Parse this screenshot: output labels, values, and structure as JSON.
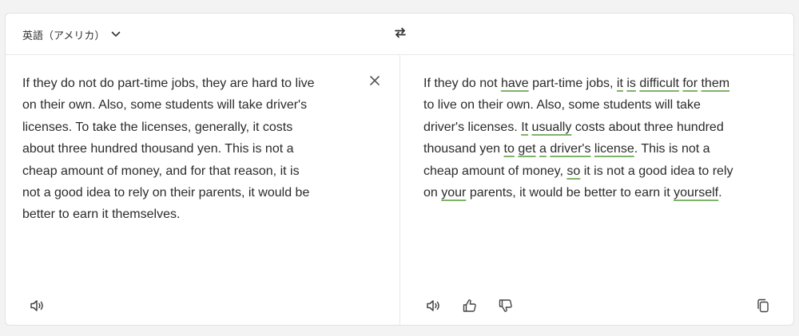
{
  "header": {
    "language_label": "英語（アメリカ）"
  },
  "icons": {
    "dropdown": "chevron-down-icon",
    "swap": "swap-arrows-icon",
    "clear": "close-icon",
    "speak": "speaker-icon",
    "like": "thumbs-up-icon",
    "dislike": "thumbs-down-icon",
    "copy": "copy-icon"
  },
  "source": {
    "lines": [
      "If they do not do part-time jobs, they are hard to live",
      "on their own. Also, some students will take driver's",
      "licenses. To take the licenses, generally, it costs",
      "about three hundred thousand yen. This is not a",
      "cheap amount of money, and for that reason, it is",
      "not a good idea to rely on their parents, it would be",
      "better to earn it themselves."
    ]
  },
  "target": {
    "lines": [
      [
        {
          "t": "If they do not ",
          "ins": false
        },
        {
          "t": "have",
          "ins": true
        },
        {
          "t": " part-time jobs, ",
          "ins": false
        },
        {
          "t": "it",
          "ins": true
        },
        {
          "t": " ",
          "ins": false
        },
        {
          "t": "is",
          "ins": true
        },
        {
          "t": " ",
          "ins": false
        },
        {
          "t": "difficult",
          "ins": true
        },
        {
          "t": " ",
          "ins": false
        },
        {
          "t": "for",
          "ins": true
        },
        {
          "t": " ",
          "ins": false
        },
        {
          "t": "them",
          "ins": true
        }
      ],
      [
        {
          "t": "to live on their own. Also, some students will take",
          "ins": false
        }
      ],
      [
        {
          "t": "driver's licenses. ",
          "ins": false
        },
        {
          "t": "It",
          "ins": true
        },
        {
          "t": " ",
          "ins": false
        },
        {
          "t": "usually",
          "ins": true
        },
        {
          "t": " costs about three hundred",
          "ins": false
        }
      ],
      [
        {
          "t": "thousand yen ",
          "ins": false
        },
        {
          "t": "to",
          "ins": true
        },
        {
          "t": " ",
          "ins": false
        },
        {
          "t": "get",
          "ins": true
        },
        {
          "t": " ",
          "ins": false
        },
        {
          "t": "a",
          "ins": true
        },
        {
          "t": " ",
          "ins": false
        },
        {
          "t": "driver's",
          "ins": true
        },
        {
          "t": " ",
          "ins": false
        },
        {
          "t": "license",
          "ins": true
        },
        {
          "t": ". This is not a",
          "ins": false
        }
      ],
      [
        {
          "t": "cheap amount of money, ",
          "ins": false
        },
        {
          "t": "so",
          "ins": true
        },
        {
          "t": " it is not a good idea to rely",
          "ins": false
        }
      ],
      [
        {
          "t": "on ",
          "ins": false
        },
        {
          "t": "your",
          "ins": true
        },
        {
          "t": " parents, it would be better to earn it ",
          "ins": false
        },
        {
          "t": "yourself",
          "ins": true
        },
        {
          "t": ".",
          "ins": false
        }
      ]
    ]
  }
}
